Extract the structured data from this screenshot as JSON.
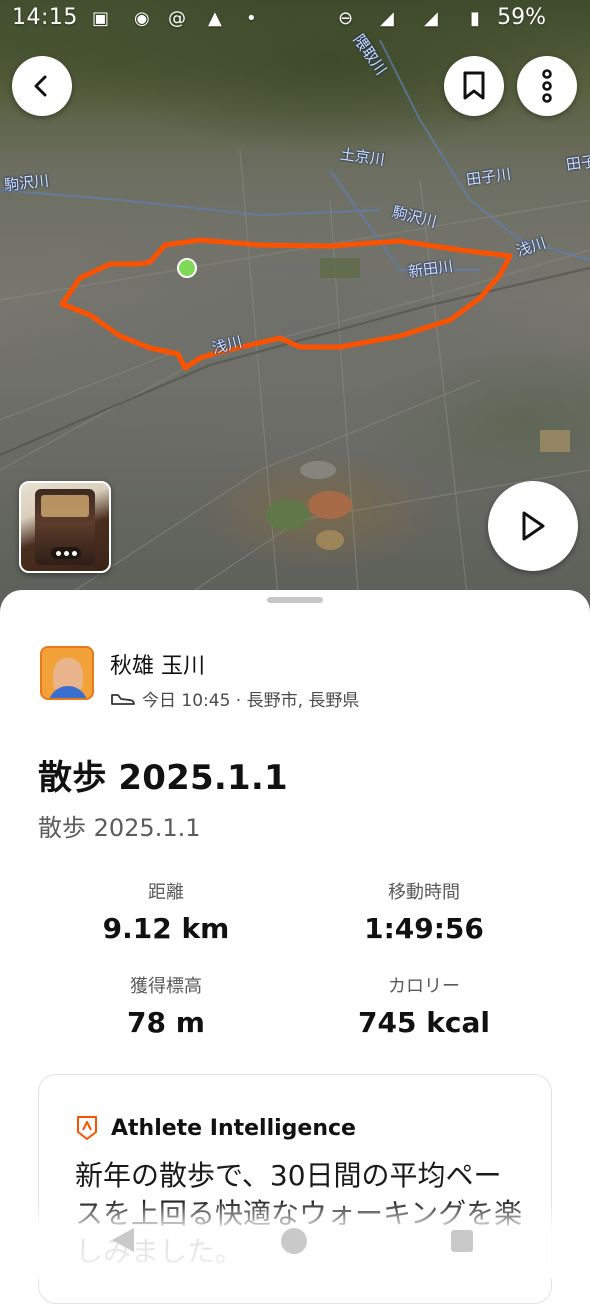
{
  "status_bar": {
    "time": "14:15",
    "battery": "59%"
  },
  "map": {
    "labels": {
      "kumotori": "隈取川",
      "jokyo": "土京川",
      "komazawa_left": "駒沢川",
      "komazawa_mid": "駒沢川",
      "tagoi": "田子川",
      "tagoi_right": "田子",
      "asakawa_right": "浅川",
      "shindenkawa": "新田川",
      "asakawa_bottom": "浅川"
    },
    "route_color": "#fc5200",
    "marker_color": "#7ed957"
  },
  "athlete": {
    "name": "秋雄 玉川",
    "meta": "今日 10:45 · 長野市, 長野県"
  },
  "activity": {
    "title": "散歩 2025.1.1",
    "description": "散歩 2025.1.1"
  },
  "stats": {
    "distance": {
      "label": "距離",
      "value": "9.12 km"
    },
    "moving_time": {
      "label": "移動時間",
      "value": "1:49:56"
    },
    "elevation": {
      "label": "獲得標高",
      "value": "78 m"
    },
    "calories": {
      "label": "カロリー",
      "value": "745 kcal"
    }
  },
  "athlete_intelligence": {
    "title": "Athlete Intelligence",
    "body": "新年の散歩で、30日間の平均ペースを上回る快適なウォーキングを楽しみました。"
  },
  "colors": {
    "accent": "#fc5200"
  }
}
